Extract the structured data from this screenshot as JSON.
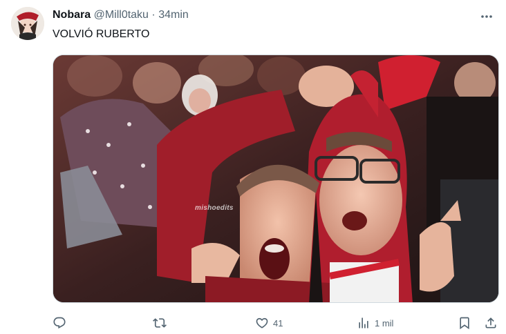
{
  "author": {
    "display_name": "Nobara",
    "handle": "@Mill0taku",
    "separator": "·",
    "time": "34min"
  },
  "tweet": {
    "text": "VOLVIÓ RUBERTO"
  },
  "media": {
    "watermark": "mishoedits"
  },
  "actions": {
    "reply_count": "",
    "retweet_count": "",
    "like_count": "41",
    "views_count": "1 mil"
  },
  "icons": {
    "more": "more-dots-icon",
    "reply": "reply-icon",
    "retweet": "retweet-icon",
    "like": "heart-icon",
    "views": "views-icon",
    "bookmark": "bookmark-icon",
    "share": "share-icon"
  },
  "colors": {
    "text": "#0f1419",
    "secondary": "#536471",
    "border": "#cfd9de"
  }
}
